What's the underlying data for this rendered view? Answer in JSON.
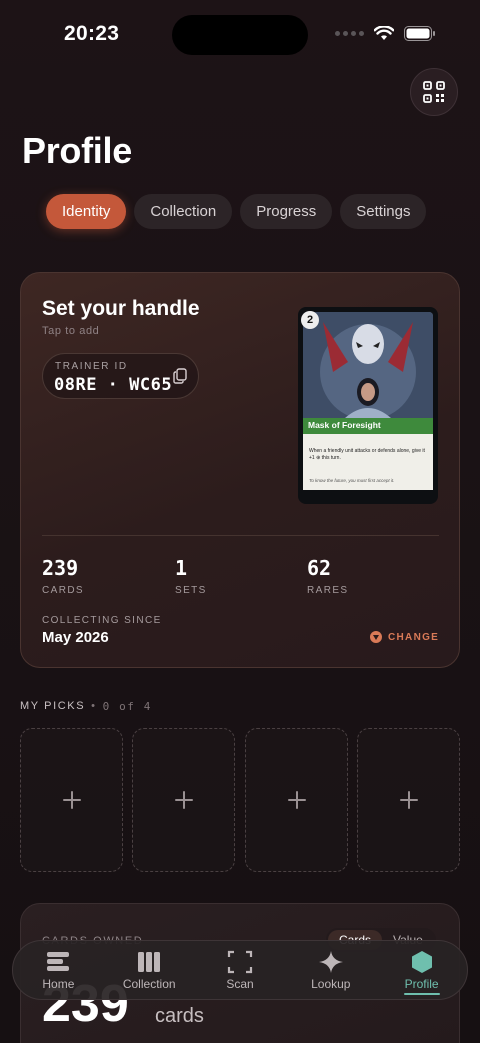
{
  "status_bar": {
    "time": "20:23"
  },
  "page": {
    "title": "Profile"
  },
  "tabs": [
    {
      "label": "Identity",
      "active": true
    },
    {
      "label": "Collection",
      "active": false
    },
    {
      "label": "Progress",
      "active": false
    },
    {
      "label": "Settings",
      "active": false
    }
  ],
  "profile": {
    "handle_title": "Set your handle",
    "handle_subtitle": "Tap to add",
    "trainer_id_label": "TRAINER ID",
    "trainer_id_value": "08RE · WC65"
  },
  "featured_card": {
    "cost": "2",
    "name": "Mask of Foresight",
    "rule_text": "When a friendly unit attacks or defends alone, give it +1 ⊕ this turn.",
    "flavor_text": "To know the future, you must first accept it."
  },
  "stats": [
    {
      "value": "239",
      "label": "CARDS"
    },
    {
      "value": "1",
      "label": "SETS"
    },
    {
      "value": "62",
      "label": "RARES"
    }
  ],
  "collecting_since": {
    "label": "COLLECTING SINCE",
    "value": "May 2026",
    "change_label": "CHANGE"
  },
  "my_picks": {
    "label": "MY PICKS",
    "count": "0 of 4",
    "slot_icon": "plus-icon"
  },
  "cards_owned": {
    "label": "CARDS OWNED",
    "value": "239",
    "unit": "cards",
    "toggle": [
      "Cards",
      "Value"
    ]
  },
  "bottom_nav": [
    {
      "label": "Home",
      "icon": "home-stack-icon"
    },
    {
      "label": "Collection",
      "icon": "collection-bars-icon"
    },
    {
      "label": "Scan",
      "icon": "scan-frame-icon"
    },
    {
      "label": "Lookup",
      "icon": "sparkle-icon"
    },
    {
      "label": "Profile",
      "icon": "hexagon-icon",
      "active": true
    }
  ],
  "colors": {
    "accent": "#c4583a",
    "active_nav": "#6fbfae",
    "change": "#d97a57"
  }
}
